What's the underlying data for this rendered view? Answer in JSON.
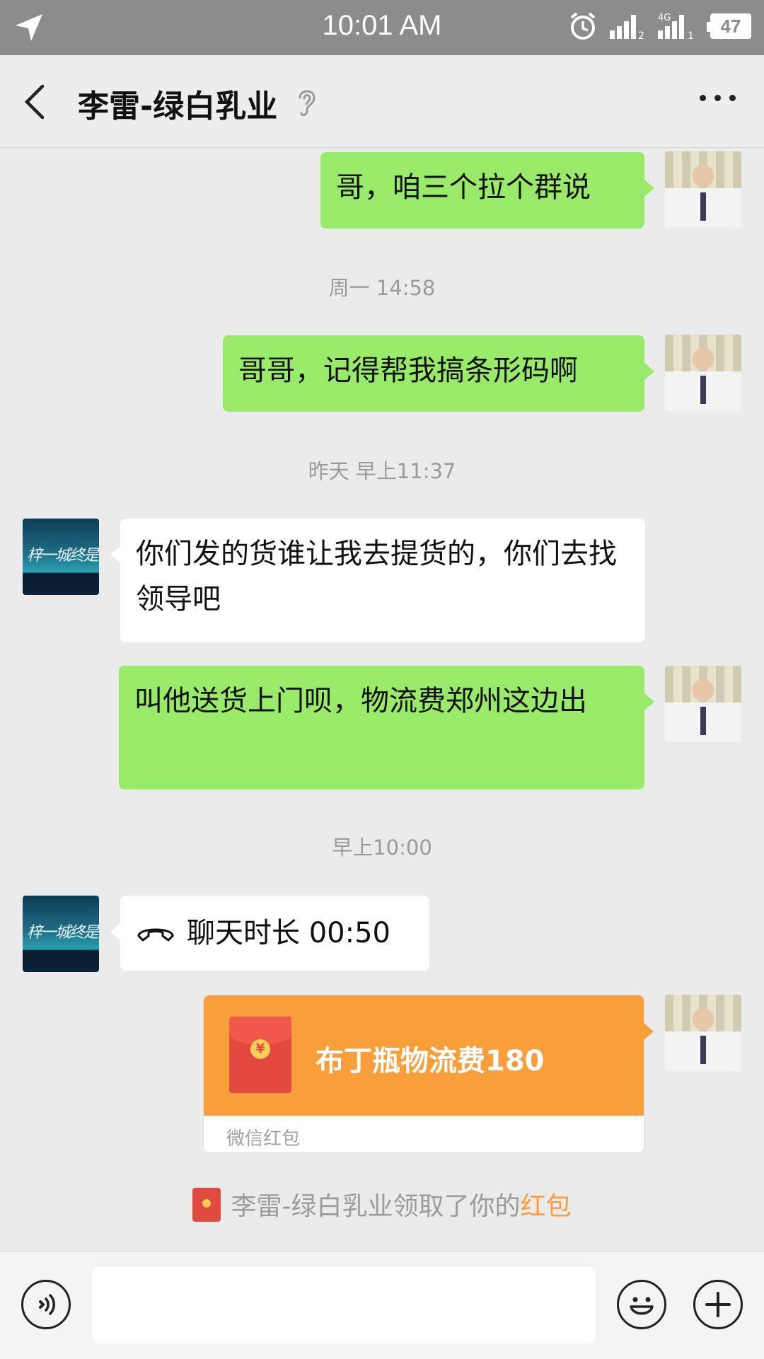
{
  "status_bar": {
    "time": "10:01 AM",
    "battery": "47",
    "network": "4G",
    "sim1": "2",
    "sim2": "1",
    "bg_color": "#8c8c8c"
  },
  "header": {
    "title": "李雷-绿白乳业"
  },
  "messages": {
    "m1": "哥，咱三个拉个群说",
    "ts1": "周一 14:58",
    "m2": "哥哥，记得帮我搞条形码啊",
    "ts2": "昨天 早上11:37",
    "m3": "你们发的货谁让我去提货的，你们去找领导吧",
    "m4": "叫他送货上门呗，物流费郑州这边出",
    "ts3": "早上10:00",
    "call_label": "聊天时长 00:50",
    "them_avatar_text": "梓一城终是一个道"
  },
  "red_packet": {
    "title": "布丁瓶物流费180",
    "source": "微信红包",
    "coin_symbol": "¥",
    "color": "#f89e3b"
  },
  "system": {
    "claimed_prefix": "李雷-绿白乳业领取了你的",
    "claimed_link": "红包"
  },
  "colors": {
    "my_bubble": "#9aea6a",
    "their_bubble": "#ffffff",
    "background": "#ebebeb"
  }
}
